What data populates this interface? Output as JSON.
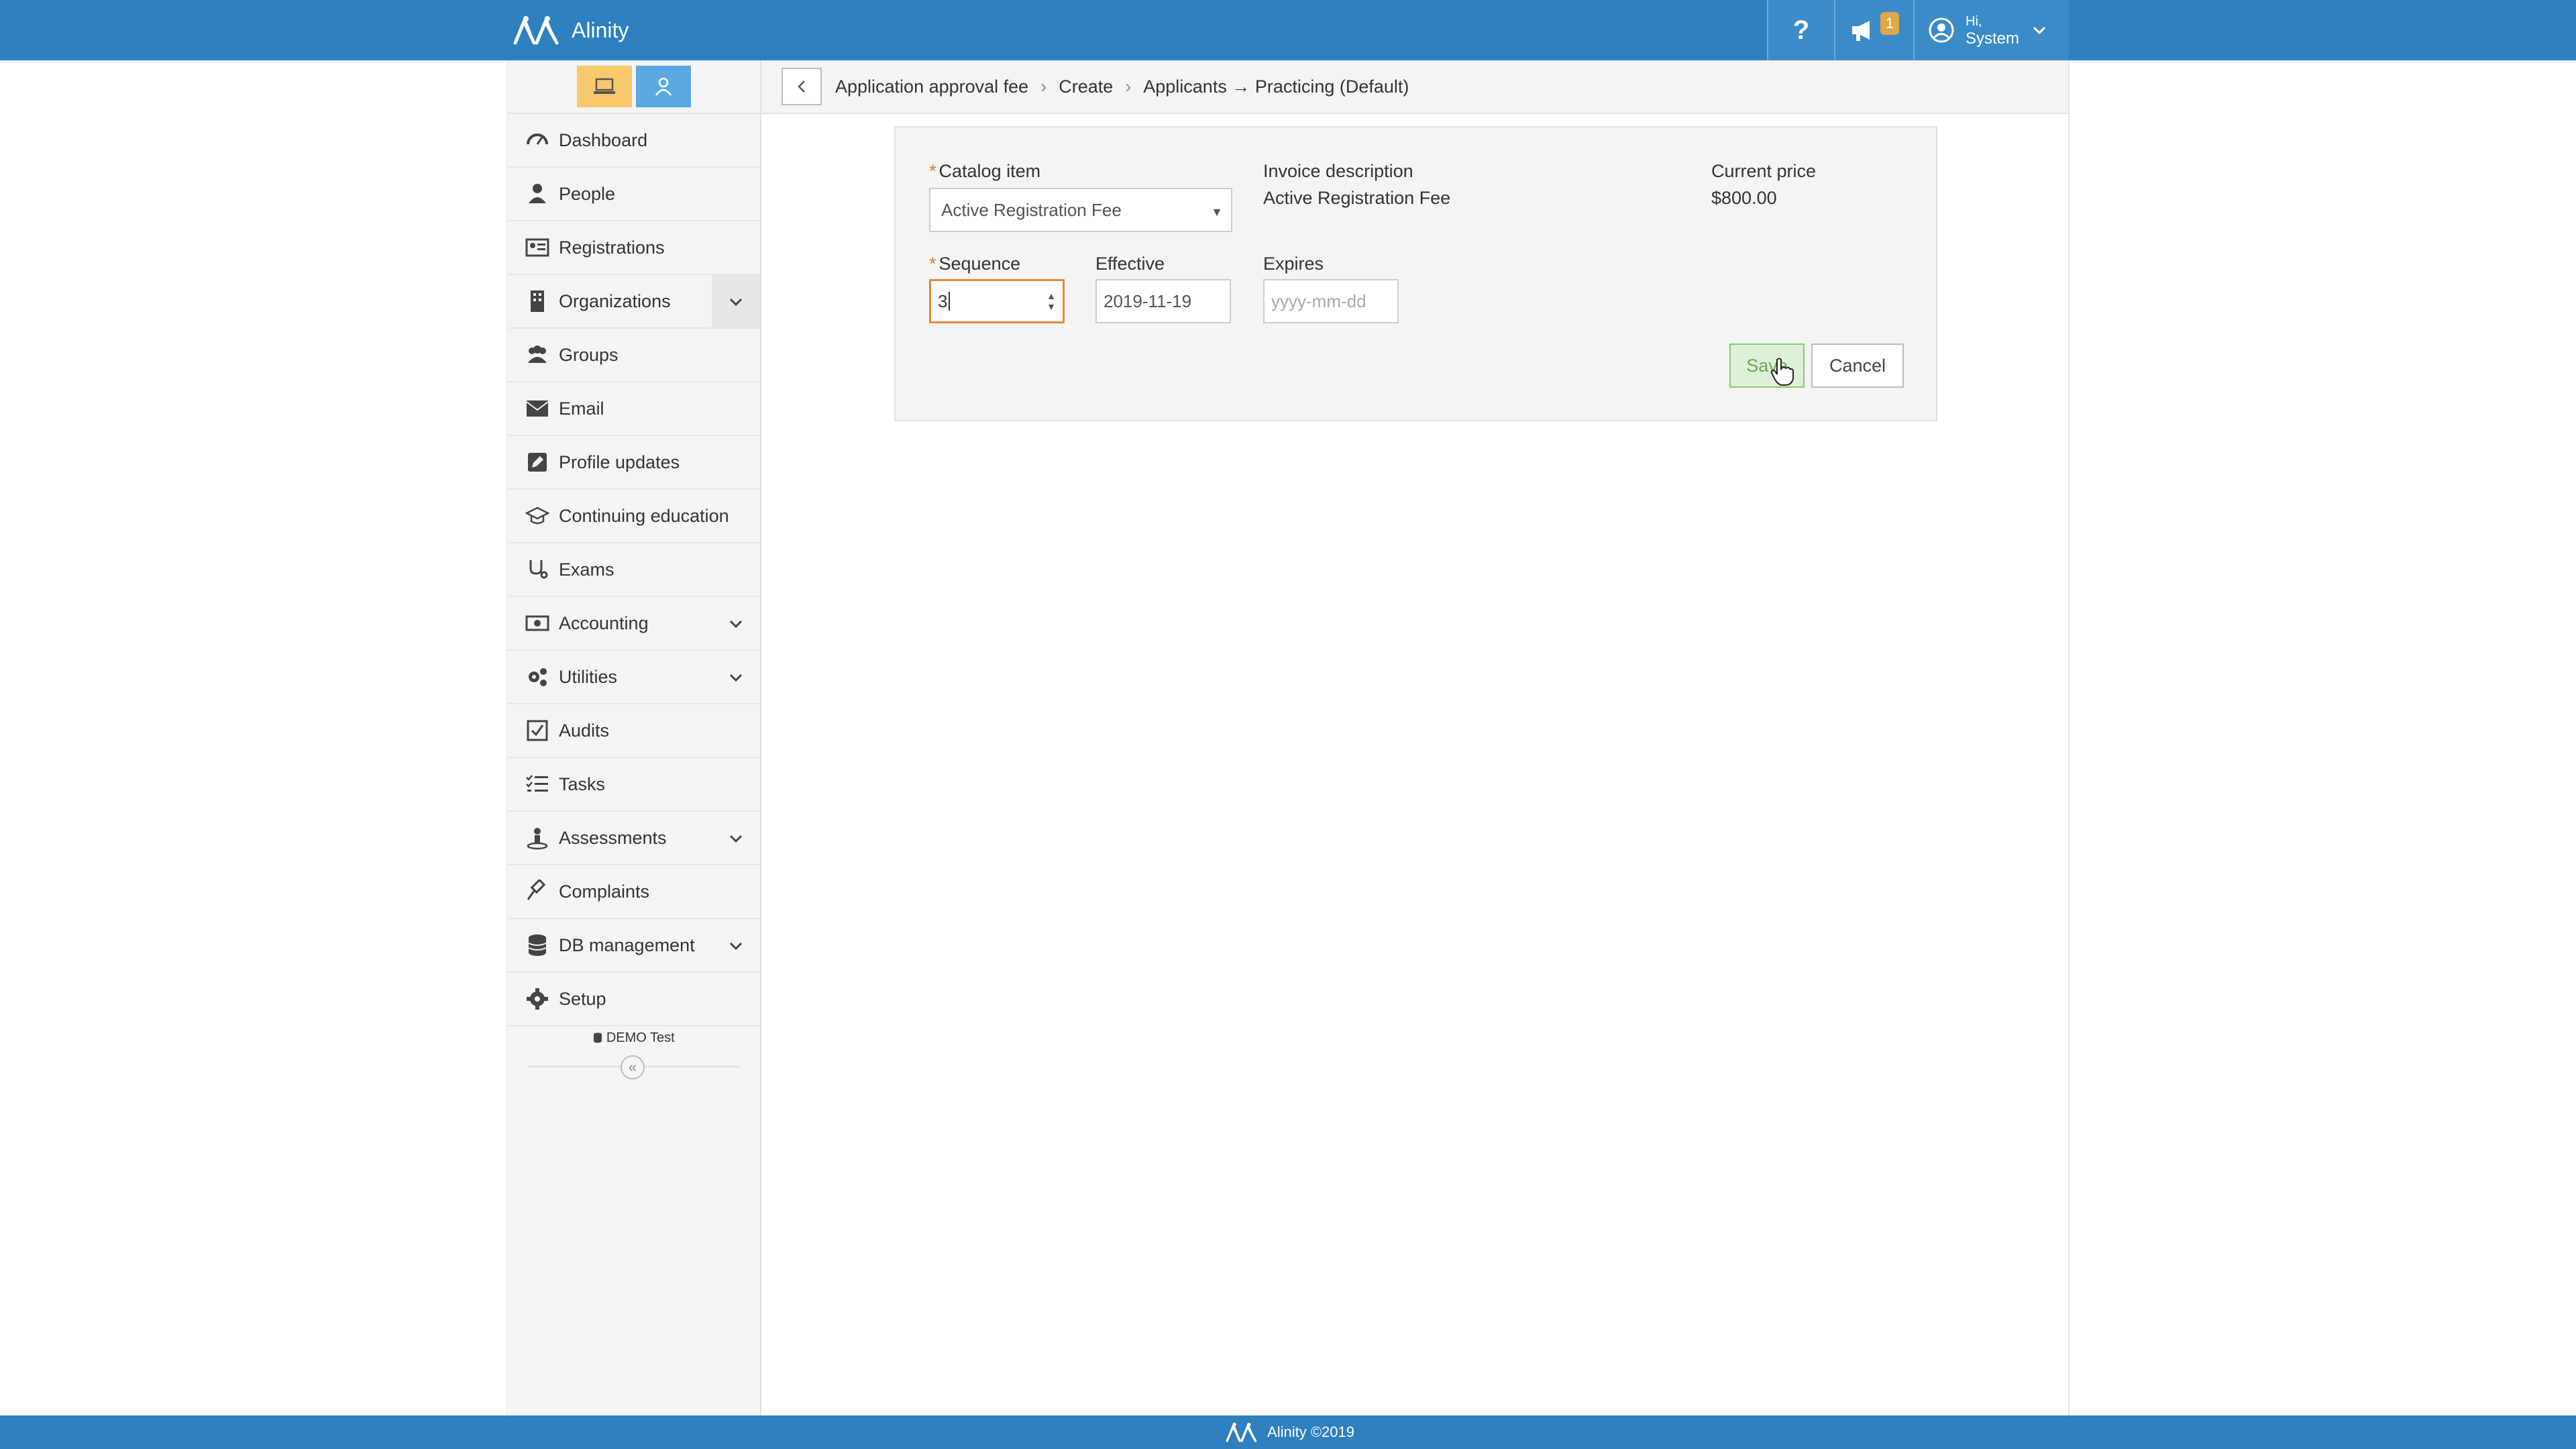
{
  "app": {
    "name": "Alinity",
    "help_label": "?",
    "notification_count": "1",
    "user_greeting": "Hi,",
    "user_name": "System"
  },
  "sidebar": {
    "items": [
      {
        "label": "Dashboard",
        "icon": "dashboard-icon"
      },
      {
        "label": "People",
        "icon": "person-icon"
      },
      {
        "label": "Registrations",
        "icon": "id-card-icon"
      },
      {
        "label": "Organizations",
        "icon": "building-icon",
        "expandable": true
      },
      {
        "label": "Groups",
        "icon": "users-icon"
      },
      {
        "label": "Email",
        "icon": "envelope-icon"
      },
      {
        "label": "Profile updates",
        "icon": "edit-icon"
      },
      {
        "label": "Continuing education",
        "icon": "graduation-cap-icon"
      },
      {
        "label": "Exams",
        "icon": "stethoscope-icon"
      },
      {
        "label": "Accounting",
        "icon": "money-icon",
        "expandable": true
      },
      {
        "label": "Utilities",
        "icon": "cogs-icon",
        "expandable": true
      },
      {
        "label": "Audits",
        "icon": "checkbox-icon"
      },
      {
        "label": "Tasks",
        "icon": "tasks-icon"
      },
      {
        "label": "Assessments",
        "icon": "assessment-icon",
        "expandable": true
      },
      {
        "label": "Complaints",
        "icon": "gavel-icon"
      },
      {
        "label": "DB management",
        "icon": "database-icon",
        "expandable": true
      },
      {
        "label": "Setup",
        "icon": "gear-icon"
      }
    ],
    "db_label": "DEMO Test",
    "collapse_label": "«"
  },
  "breadcrumb": {
    "items": [
      "Application approval fee",
      "Create",
      "Applicants → Practicing (Default)"
    ]
  },
  "form": {
    "catalog_item_label": "Catalog item",
    "catalog_item_value": "Active Registration Fee",
    "invoice_description_label": "Invoice description",
    "invoice_description_value": "Active Registration Fee",
    "current_price_label": "Current price",
    "current_price_value": "$800.00",
    "sequence_label": "Sequence",
    "sequence_value": "3",
    "effective_label": "Effective",
    "effective_value": "2019-11-19",
    "expires_label": "Expires",
    "expires_placeholder": "yyyy-mm-dd",
    "required_mark": "*",
    "save_label": "Save",
    "cancel_label": "Cancel"
  },
  "footer": {
    "text": "Alinity ©2019"
  }
}
